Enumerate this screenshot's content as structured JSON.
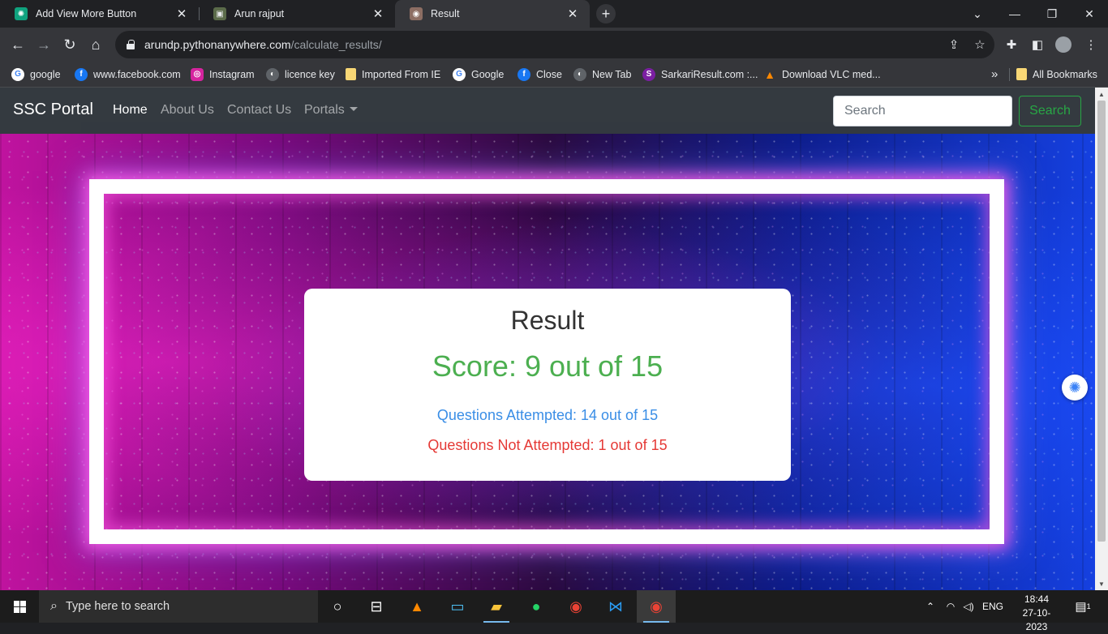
{
  "browser": {
    "tabs": [
      {
        "title": "Add View More Button",
        "favicon": "chatgpt-icon"
      },
      {
        "title": "Arun rajput",
        "favicon": "profile-image-icon"
      },
      {
        "title": "Result",
        "favicon": "site-icon"
      }
    ],
    "new_tab_label": "+",
    "url_host": "arundp.pythonanywhere.com",
    "url_path": "/calculate_results/",
    "bookmarks": [
      {
        "label": "google",
        "icon": "google-icon",
        "color": "#4285f4"
      },
      {
        "label": "www.facebook.com",
        "icon": "facebook-icon",
        "color": "#1877f2"
      },
      {
        "label": "Instagram",
        "icon": "instagram-icon",
        "color": "#d6249f"
      },
      {
        "label": "licence key",
        "icon": "globe-icon",
        "color": "#9aa0a6"
      },
      {
        "label": "Imported From IE",
        "icon": "folder-icon",
        "color": "#f8d775"
      },
      {
        "label": "Google",
        "icon": "google-icon",
        "color": "#4285f4"
      },
      {
        "label": "Close",
        "icon": "facebook-icon",
        "color": "#1877f2"
      },
      {
        "label": "New Tab",
        "icon": "globe-icon",
        "color": "#9aa0a6"
      },
      {
        "label": "SarkariResult.com :...",
        "icon": "site-icon",
        "color": "#7b1fa2"
      },
      {
        "label": "Download VLC med...",
        "icon": "vlc-icon",
        "color": "#ff8800"
      }
    ],
    "bookmarks_overflow": "»",
    "all_bookmarks_label": "All Bookmarks"
  },
  "site": {
    "brand": "SSC Portal",
    "nav": [
      {
        "label": "Home",
        "active": true
      },
      {
        "label": "About Us",
        "active": false
      },
      {
        "label": "Contact Us",
        "active": false
      },
      {
        "label": "Portals",
        "active": false
      }
    ],
    "search_placeholder": "Search",
    "search_button": "Search"
  },
  "result": {
    "title": "Result",
    "score": "Score: 9 out of 15",
    "attempted": "Questions Attempted: 14 out of 15",
    "not_attempted": "Questions Not Attempted: 1 out of 15",
    "colors": {
      "score": "#4caf50",
      "attempted": "#3a8ee6",
      "not_attempted": "#e53935"
    }
  },
  "taskbar": {
    "search_placeholder": "Type here to search",
    "language": "ENG",
    "time": "18:44",
    "date": "27-10-2023",
    "notification_count": "1"
  }
}
